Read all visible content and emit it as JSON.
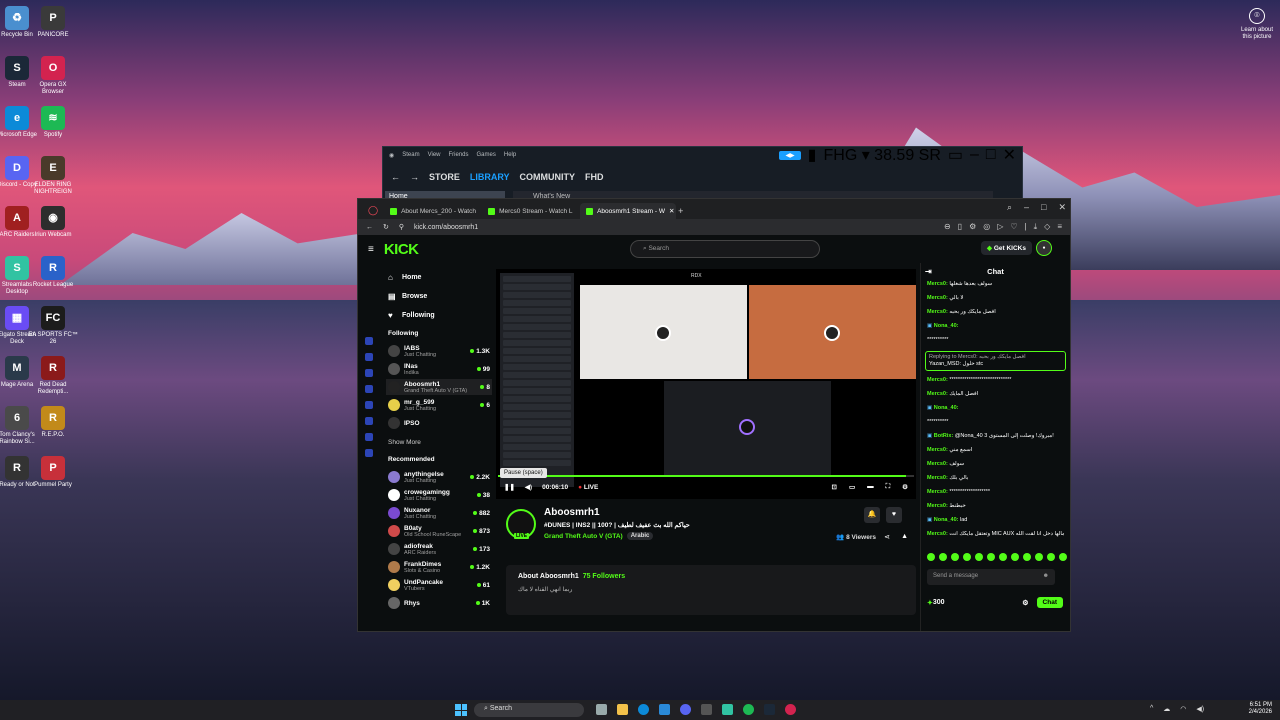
{
  "desktop": {
    "icons": [
      {
        "label": "Recycle Bin",
        "color": "#4a8fcf",
        "glyph": "♻"
      },
      {
        "label": "PANICORE",
        "color": "#3a3a3a",
        "glyph": "P"
      },
      {
        "label": "Steam",
        "color": "#1b2838",
        "glyph": "S"
      },
      {
        "label": "Opera GX Browser",
        "color": "#d3234f",
        "glyph": "O"
      },
      {
        "label": "Microsoft Edge",
        "color": "#0c8ad8",
        "glyph": "e"
      },
      {
        "label": "Spotify",
        "color": "#1db954",
        "glyph": "≋"
      },
      {
        "label": "Discord - Copy",
        "color": "#5865f2",
        "glyph": "D"
      },
      {
        "label": "ELDEN RING NIGHTREIGN",
        "color": "#4a3a2a",
        "glyph": "E"
      },
      {
        "label": "ARC Raiders",
        "color": "#a02020",
        "glyph": "A"
      },
      {
        "label": "Iriun Webcam",
        "color": "#2d2d2d",
        "glyph": "◉"
      },
      {
        "label": "Streamlabs Desktop",
        "color": "#31c3a2",
        "glyph": "S"
      },
      {
        "label": "Rocket League",
        "color": "#2a62c9",
        "glyph": "R"
      },
      {
        "label": "Elgato Stream Deck",
        "color": "#6a4cf5",
        "glyph": "▦"
      },
      {
        "label": "EA SPORTS FC™ 26",
        "color": "#1c1c1c",
        "glyph": "FC"
      },
      {
        "label": "Mage Arena",
        "color": "#2a3a4a",
        "glyph": "M"
      },
      {
        "label": "Red Dead Redempti...",
        "color": "#8b1a1a",
        "glyph": "R"
      },
      {
        "label": "Tom Clancy's Rainbow Si...",
        "color": "#4a4a4a",
        "glyph": "6"
      },
      {
        "label": "R.E.P.O.",
        "color": "#c28a1a",
        "glyph": "R"
      },
      {
        "label": "Ready or Not",
        "color": "#333333",
        "glyph": "R"
      },
      {
        "label": "Pummel Party",
        "color": "#c7303a",
        "glyph": "P"
      }
    ],
    "learn": "Learn about this picture"
  },
  "steam": {
    "menu": [
      "Steam",
      "View",
      "Friends",
      "Games",
      "Help"
    ],
    "nav": [
      "STORE",
      "LIBRARY",
      "COMMUNITY",
      "FHD"
    ],
    "home": "Home",
    "whats_new": "What's New",
    "account": "FHG ▾ 38.59 SR"
  },
  "browser": {
    "tabs": [
      "About Mercs_200 - Watch",
      "Mercs0 Stream - Watch L",
      "Aboosmrh1 Stream - W"
    ],
    "url": "kick.com/aboosmrh1"
  },
  "kick": {
    "logo": "KICK",
    "search_placeholder": "Search",
    "get_kicks": "Get KICKs",
    "nav": {
      "home": "Home",
      "browse": "Browse",
      "following": "Following"
    },
    "following_header": "Following",
    "following": [
      {
        "name": "IABS",
        "cat": "Just Chatting",
        "viewers": "1.3K",
        "color": "#444"
      },
      {
        "name": "INas",
        "cat": "Indika",
        "viewers": "99",
        "color": "#555"
      },
      {
        "name": "Aboosmrh1",
        "cat": "Grand Theft Auto V (GTA)",
        "viewers": "8",
        "color": "#222"
      },
      {
        "name": "mr_g_599",
        "cat": "Just Chatting",
        "viewers": "6",
        "color": "#e6d04a"
      },
      {
        "name": "IPSO",
        "cat": "",
        "viewers": "",
        "color": "#333"
      }
    ],
    "show_more": "Show More",
    "recommended_header": "Recommended",
    "recommended": [
      {
        "name": "anythingelse",
        "cat": "Just Chatting",
        "viewers": "2.2K",
        "color": "#8a7ad0"
      },
      {
        "name": "crowegamingg",
        "cat": "Just Chatting",
        "viewers": "38",
        "color": "#fff"
      },
      {
        "name": "Nuxanor",
        "cat": "Just Chatting",
        "viewers": "882",
        "color": "#7a4ad0"
      },
      {
        "name": "B0aty",
        "cat": "Old School RuneScape",
        "viewers": "873",
        "color": "#d04a4a"
      },
      {
        "name": "adiofreak",
        "cat": "ARC Raiders",
        "viewers": "173",
        "color": "#444"
      },
      {
        "name": "FrankDimes",
        "cat": "Slots & Casino",
        "viewers": "1.2K",
        "color": "#b07a4a"
      },
      {
        "name": "UndPancake",
        "cat": "VTubers",
        "viewers": "61",
        "color": "#f0d060"
      },
      {
        "name": "Rhys",
        "cat": "",
        "viewers": "1K",
        "color": "#666"
      }
    ],
    "player": {
      "tooltip": "Pause (space)",
      "time": "00:06:10",
      "live": "LIVE",
      "overlay_top": "RDX"
    },
    "stream": {
      "name": "Aboosmrh1",
      "title": "#DUNES | INS2 || 100? | حياكم الله بث عفيف لطيف",
      "category": "Grand Theft Auto V (GTA)",
      "tag": "Arabic",
      "live_badge": "LIVE",
      "viewers": "8 Viewers"
    },
    "about": {
      "title": "About Aboosmrh1",
      "followers": "75 Followers",
      "desc": "ربما انهي القناه لا ماك"
    },
    "chat": {
      "title": "Chat",
      "messages": [
        {
          "user": "Mercs0:",
          "text": "سولف بعدها شغلها",
          "bot": false
        },
        {
          "user": "Mercs0:",
          "text": "لا بالي",
          "bot": false
        },
        {
          "user": "Mercs0:",
          "text": "افصل مايكك ور بحبه",
          "bot": false
        },
        {
          "user": "Nona_40:",
          "text": "",
          "bot": true
        },
        {
          "user": "",
          "text": "**********",
          "bot": false
        }
      ],
      "reply_quote": "Replying to Mercs0: افصل مايكك ور بحبه",
      "reply_user": "Yazan_MSD:",
      "reply_text": "خلول stc",
      "messages2": [
        {
          "user": "Mercs0:",
          "text": "*****************************",
          "bot": false
        },
        {
          "user": "Mercs0:",
          "text": "افصل المايك",
          "bot": false
        },
        {
          "user": "Nona_40:",
          "text": "",
          "bot": true
        },
        {
          "user": "",
          "text": "**********",
          "bot": false
        },
        {
          "user": "BotRix:",
          "text": "@Nona_40 مبروك! وصلت إلى المستوى 3!",
          "bot": true
        },
        {
          "user": "Mercs0:",
          "text": "اسمع مني",
          "bot": false
        },
        {
          "user": "Mercs0:",
          "text": "سولف",
          "bot": false
        },
        {
          "user": "Mercs0:",
          "text": "بالي بلك",
          "bot": false
        },
        {
          "user": "Mercs0:",
          "text": "*******************",
          "bot": false
        },
        {
          "user": "Mercs0:",
          "text": "خبطنط",
          "bot": false
        },
        {
          "user": "Nona_40:",
          "text": "lad",
          "bot": true
        },
        {
          "user": "Mercs0:",
          "text": "وتعتقل مايكك انت MIC AUX مالها دخل انا لقت الله",
          "bot": false
        }
      ],
      "send_placeholder": "Send a message",
      "points": "300",
      "chat_btn": "Chat"
    }
  },
  "taskbar": {
    "search": "Search",
    "time": "6:51 PM",
    "date": "2/4/2026"
  }
}
